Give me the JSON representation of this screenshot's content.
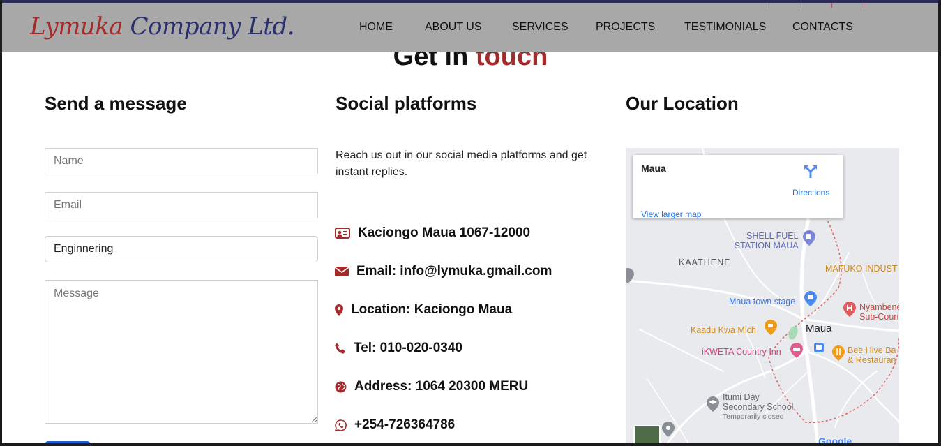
{
  "header": {
    "logo_part1": "Lymuka",
    "logo_part2": "Company Ltd.",
    "nav": [
      "HOME",
      "ABOUT US",
      "SERVICES",
      "PROJECTS",
      "TESTIMONIALS",
      "CONTACTS"
    ]
  },
  "page": {
    "heading_part1": "Get in",
    "heading_part2": "touch"
  },
  "form": {
    "title": "Send a message",
    "name_placeholder": "Name",
    "email_placeholder": "Email",
    "subject_value": "Enginnering",
    "message_placeholder": "Message"
  },
  "social": {
    "title": "Social platforms",
    "description": "Reach us out in our social media platforms and get instant replies.",
    "contacts": [
      {
        "icon": "id-card-icon",
        "text": "Kaciongo Maua 1067-12000"
      },
      {
        "icon": "envelope-icon",
        "text": "Email: info@lymuka.gmail.com"
      },
      {
        "icon": "map-marker-icon",
        "text": "Location: Kaciongo Maua"
      },
      {
        "icon": "phone-icon",
        "text": "Tel: 010-020-0340"
      },
      {
        "icon": "globe-icon",
        "text": "Address: 1064 20300 MERU"
      },
      {
        "icon": "whatsapp-icon",
        "text": "+254-726364786"
      }
    ]
  },
  "location": {
    "title": "Our Location",
    "map": {
      "place_name": "Maua",
      "directions_label": "Directions",
      "larger_map_label": "View larger map",
      "labels": {
        "shell_line1": "SHELL FUEL",
        "shell_line2": "STATION MAUA",
        "kaathene": "KAATHENE",
        "mafuko": "MAFUKO INDUST",
        "stage": "Maua town stage",
        "nyambene_line1": "Nyambene",
        "nyambene_line2": "Sub-Coun",
        "kaadu": "Kaadu Kwa Mich",
        "maua": "Maua",
        "ikweta": "iKWETA Country Inn",
        "beehive_line1": "Bee Hive Ba",
        "beehive_line2": "& Restauran",
        "itumi_line1": "Itumi Day",
        "itumi_line2": "Secondary School",
        "itumi_status": "Temporarily closed",
        "google": "Google"
      }
    }
  },
  "colors": {
    "accent": "#a52a2a",
    "navy": "#2a2f6e",
    "header_bg": "#a8a8a8",
    "link_blue": "#1a73e8"
  }
}
